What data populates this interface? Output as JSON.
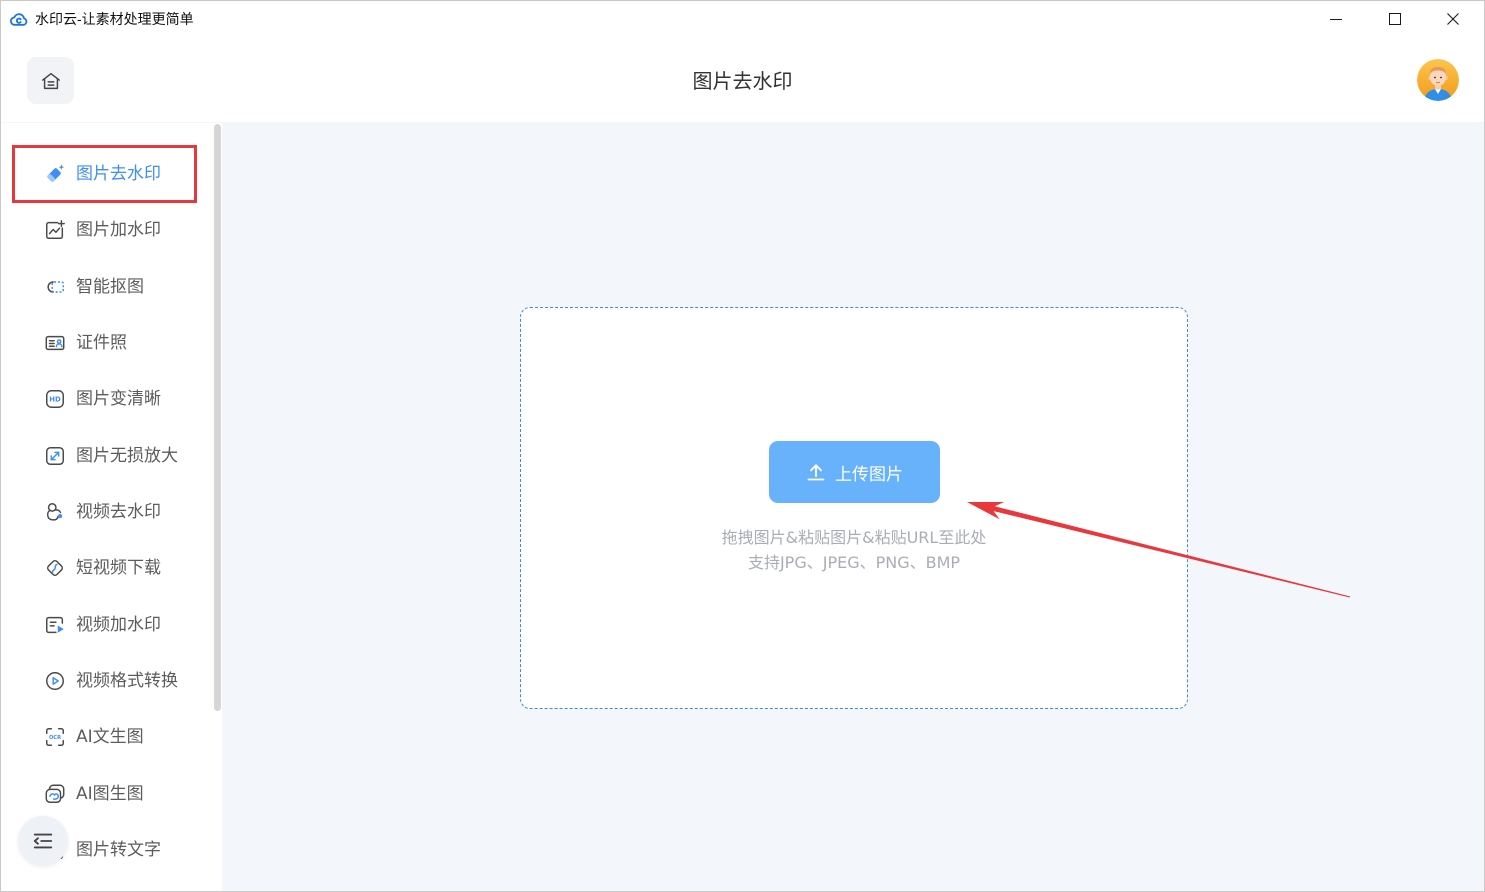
{
  "window": {
    "title": "水印云-让素材处理更简单",
    "app_icon": "cloud-logo-icon",
    "controls": [
      "minimize-icon",
      "maximize-icon",
      "close-icon"
    ]
  },
  "header": {
    "home_icon": "home-icon",
    "title": "图片去水印",
    "avatar_icon": "user-avatar-icon"
  },
  "sidebar": {
    "items": [
      {
        "label": "图片去水印",
        "icon": "eraser-icon",
        "selected": true
      },
      {
        "label": "图片加水印",
        "icon": "image-add-icon",
        "selected": false
      },
      {
        "label": "智能抠图",
        "icon": "cutout-icon",
        "selected": false
      },
      {
        "label": "证件照",
        "icon": "id-card-icon",
        "selected": false
      },
      {
        "label": "图片变清晰",
        "icon": "hd-icon",
        "selected": false
      },
      {
        "label": "图片无损放大",
        "icon": "enlarge-icon",
        "selected": false
      },
      {
        "label": "视频去水印",
        "icon": "video-remove-icon",
        "selected": false
      },
      {
        "label": "短视频下载",
        "icon": "video-download-icon",
        "selected": false
      },
      {
        "label": "视频加水印",
        "icon": "video-watermark-icon",
        "selected": false
      },
      {
        "label": "视频格式转换",
        "icon": "format-convert-icon",
        "selected": false
      },
      {
        "label": "AI文生图",
        "icon": "ocr-scan-icon",
        "selected": false
      },
      {
        "label": "AI图生图",
        "icon": "image-to-image-icon",
        "selected": false
      },
      {
        "label": "图片转文字",
        "icon": "image-to-text-icon",
        "selected": false
      }
    ],
    "collapse_icon": "collapse-menu-icon"
  },
  "icon_text": {
    "hd": "HD",
    "ocr": "OCR"
  },
  "upload": {
    "button_label": "上传图片",
    "button_icon": "upload-icon",
    "hint_drop": "拖拽图片&粘贴图片&粘贴URL至此处",
    "hint_formats": "支持JPG、JPEG、PNG、BMP"
  },
  "colors": {
    "accent": "#3d8ef7",
    "upload_button": "#67b2fb",
    "annotation": "#e8383d",
    "content_background": "#f3f6fa",
    "drop_zone_border": "#3b8be0"
  }
}
